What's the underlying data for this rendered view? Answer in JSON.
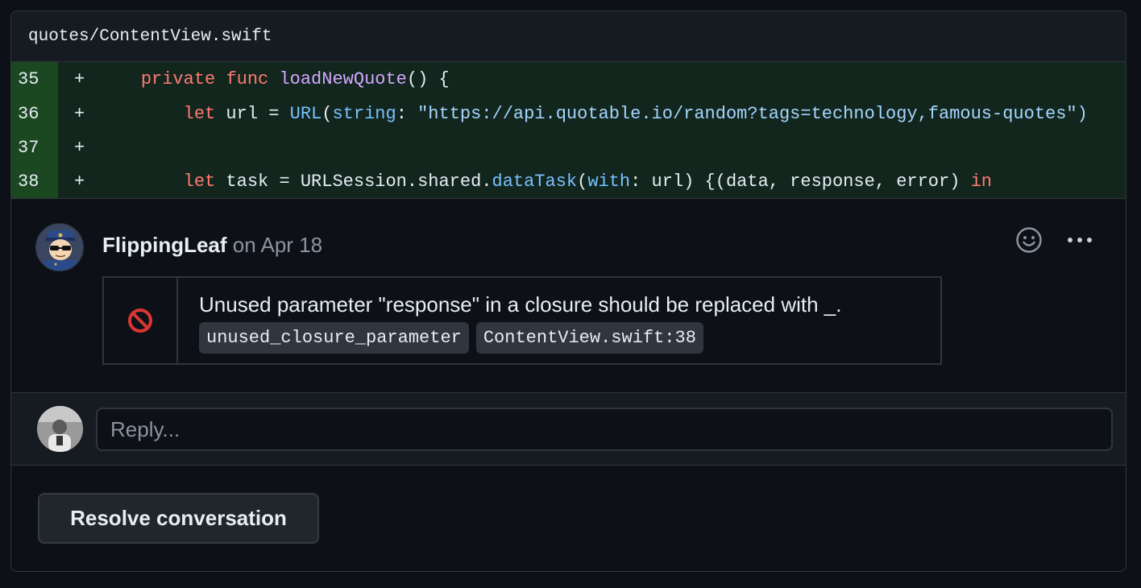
{
  "file": {
    "path": "quotes/ContentView.swift"
  },
  "diff": {
    "rows": [
      {
        "line": "35",
        "sign": "+"
      },
      {
        "line": "36",
        "sign": "+"
      },
      {
        "line": "37",
        "sign": "+"
      },
      {
        "line": "38",
        "sign": "+"
      }
    ],
    "code": {
      "r35": {
        "indent": "    ",
        "kw1": "private",
        "kw2": "func",
        "fn": "loadNewQuote",
        "rest": "() {"
      },
      "r36": {
        "indent": "        ",
        "kw": "let",
        "plain1": " url = ",
        "type": "URL",
        "paren": "(",
        "param": "string",
        "colon": ": ",
        "str": "\"https://api.quotable.io/random?tags=technology,famous-quotes\")"
      },
      "r38": {
        "indent": "        ",
        "kw": "let",
        "plain1": " task = URLSession.shared.",
        "fn": "dataTask",
        "paren": "(",
        "param": "with",
        "plain2": ": url) {(data, response, error) ",
        "kw2": "in"
      }
    }
  },
  "comment": {
    "author": "FlippingLeaf",
    "date": "on Apr 18",
    "lint": {
      "message": "Unused parameter \"response\" in a closure should be replaced with _.",
      "rule": "unused_closure_parameter",
      "location": "ContentView.swift:38",
      "icon": "prohibited-icon"
    }
  },
  "reply": {
    "placeholder": "Reply..."
  },
  "actions": {
    "resolve_label": "Resolve conversation"
  },
  "colors": {
    "added_bg": "#12261e",
    "added_gutter": "#1b4721",
    "keyword": "#ff7b72",
    "function": "#d2a8ff",
    "type": "#79c0ff",
    "prohibited": "#da3633"
  }
}
